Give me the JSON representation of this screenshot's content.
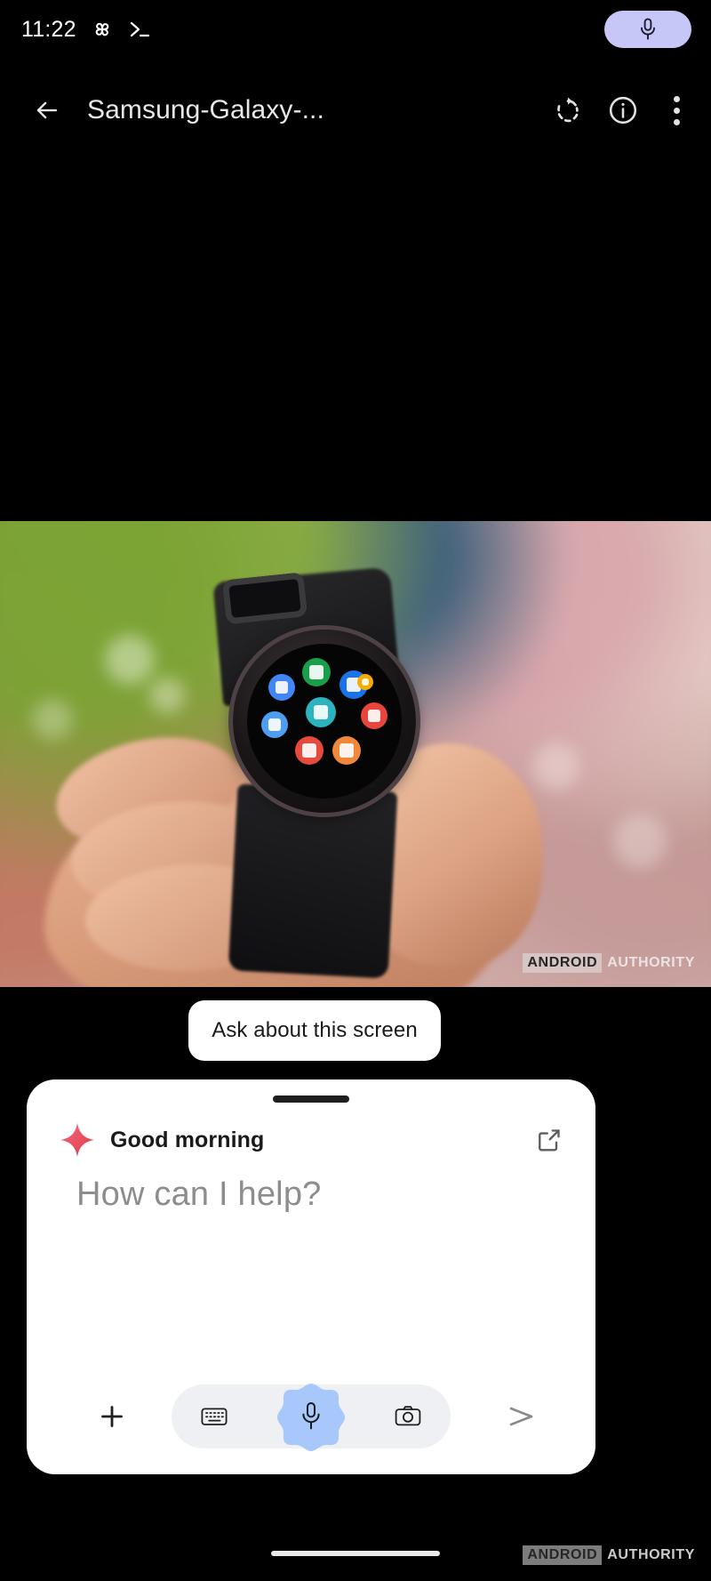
{
  "status_bar": {
    "clock": "11:22",
    "icons": [
      "pinwheel-icon",
      "terminal-icon"
    ],
    "privacy_indicator": {
      "icon": "microphone-icon",
      "background_color": "#c6c7f7"
    }
  },
  "app_bar": {
    "back_icon": "arrow-back-icon",
    "title": "Samsung-Galaxy-...",
    "actions": [
      {
        "name": "rotate-icon"
      },
      {
        "name": "info-icon"
      },
      {
        "name": "overflow-menu-icon"
      }
    ]
  },
  "viewer": {
    "background_color": "#000000",
    "photo": {
      "description": "hand-holding-galaxy-watch",
      "watermark_primary": "ANDROID",
      "watermark_secondary": "AUTHORITY",
      "watch_app_colors": [
        "#1a9e4b",
        "#1a73e8",
        "#e8453c",
        "#4285f4",
        "#2bb3c0",
        "#ea4335",
        "#34a853",
        "#1a73e8",
        "#f9ab00"
      ]
    }
  },
  "ask_chip": {
    "label": "Ask about this screen"
  },
  "gemini_sheet": {
    "greeting": "Good morning",
    "sparkle_icon": "gemini-sparkle-icon",
    "sparkle_color": "#e8505f",
    "expand_icon": "open-in-new-icon",
    "prompt_placeholder": "How can I help?",
    "input_value": "",
    "toolbar": {
      "add_label": "+",
      "keyboard_icon": "keyboard-icon",
      "mic_icon": "microphone-icon",
      "mic_blob_color": "#a8c7fa",
      "camera_icon": "camera-icon",
      "send_icon": "send-icon",
      "pill_background": "#eef0f3"
    }
  },
  "nav_bar": {
    "home_indicator": "home-indicator",
    "watermark_primary": "ANDROID",
    "watermark_secondary": "AUTHORITY"
  }
}
